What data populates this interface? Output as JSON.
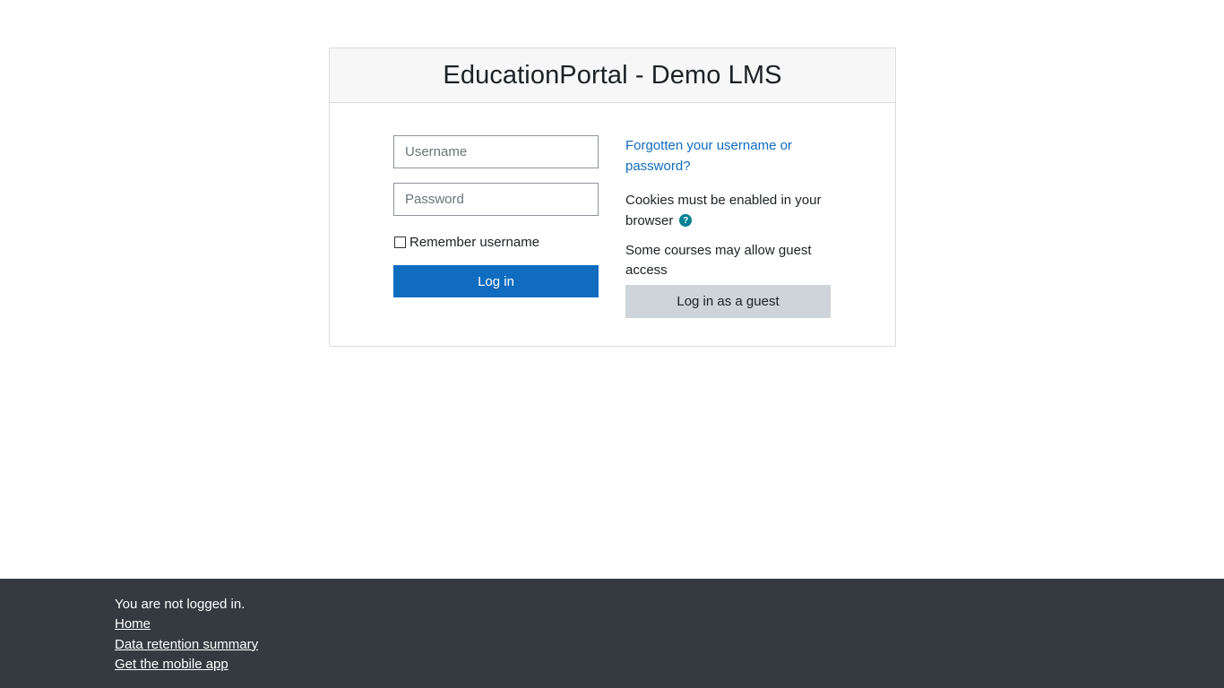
{
  "site": {
    "title": "EducationPortal - Demo LMS"
  },
  "login_form": {
    "username_placeholder": "Username",
    "username_value": "",
    "password_placeholder": "Password",
    "password_value": "",
    "remember_label": "Remember username",
    "remember_checked": false,
    "login_button_label": "Log in"
  },
  "side_info": {
    "forgot_link": "Forgotten your username or password?",
    "cookies_text": "Cookies must be enabled in your browser",
    "help_icon_glyph": "?",
    "guest_text": "Some courses may allow guest access",
    "guest_button_label": "Log in as a guest"
  },
  "colors": {
    "primary": "#0f6cbf",
    "secondary_button": "#ced4da",
    "help_icon": "#008196",
    "footer_bg": "#343a40"
  },
  "footer": {
    "status": "You are not logged in.",
    "links": [
      {
        "label": "Home"
      },
      {
        "label": "Data retention summary"
      },
      {
        "label": "Get the mobile app"
      }
    ]
  }
}
